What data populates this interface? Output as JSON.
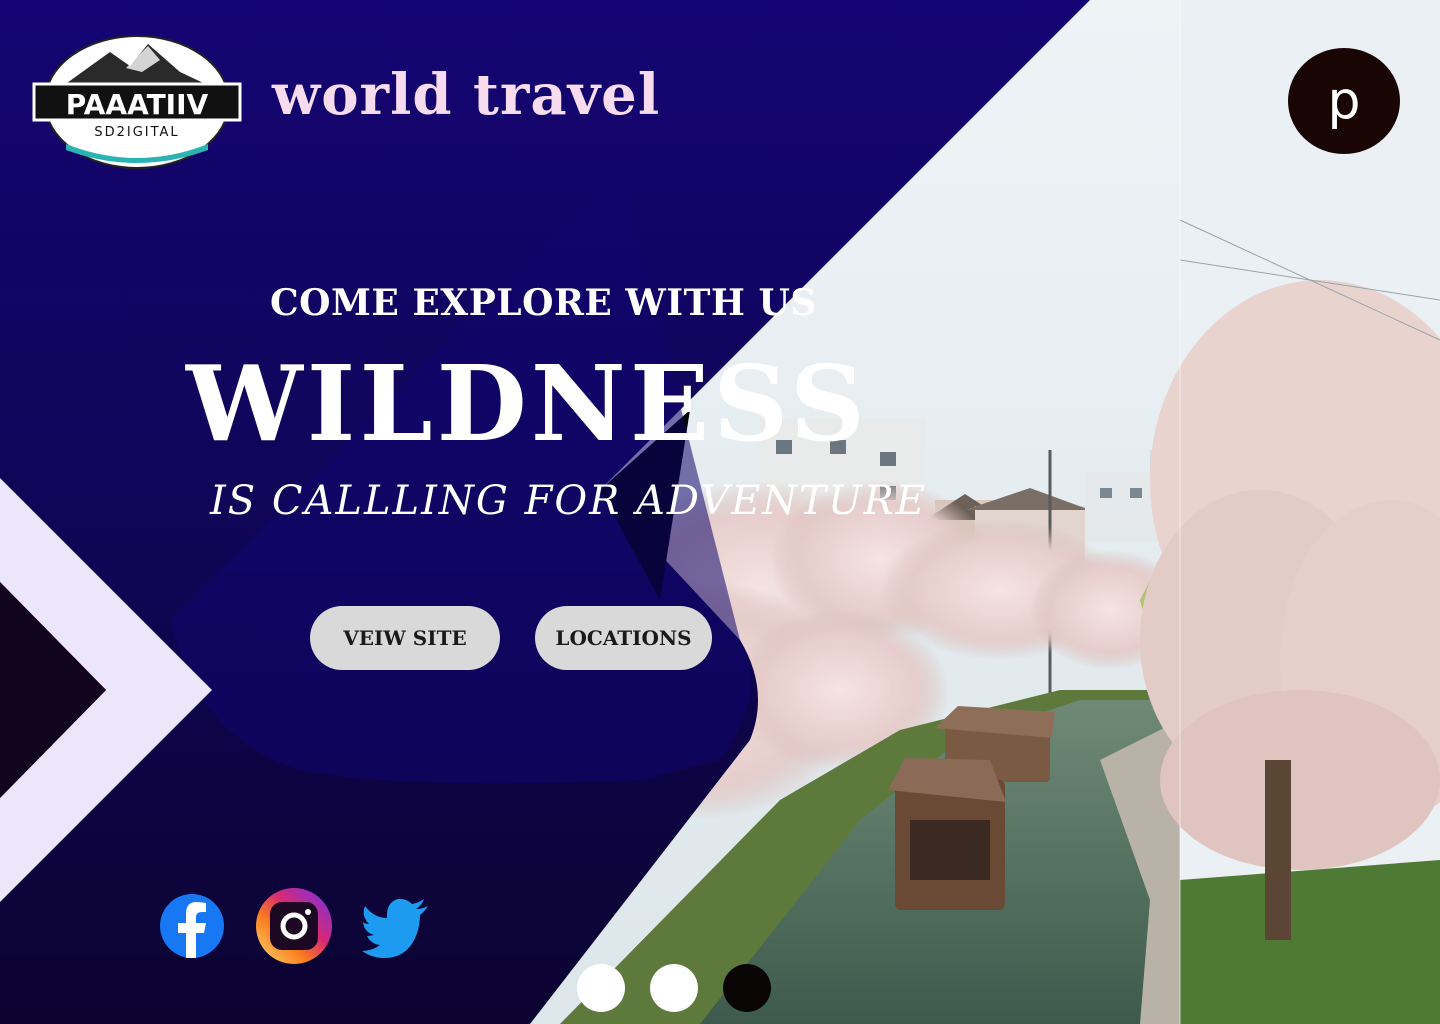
{
  "logo": {
    "main_text": "PAAATIIV",
    "sub_text": "SD2IGITAL"
  },
  "header": {
    "site_title": "world travel",
    "profile_button_label": "p"
  },
  "hero": {
    "tagline": "COME EXPLORE WITH US",
    "headline": "WILDNESS",
    "subline": "IS CALLLING FOR ADVENTURE"
  },
  "buttons": {
    "view_site": "VEIW SITE",
    "locations": "LOCATIONS"
  },
  "social": {
    "icons": [
      "facebook-icon",
      "instagram-icon",
      "twitter-icon"
    ]
  },
  "carousel": {
    "dot_count": 3,
    "active_index": 2
  },
  "colors": {
    "navy": "#12056e",
    "deep_navy": "#0e0738",
    "chevron": "#ece6fa",
    "title_pink": "#f6dcec",
    "button_gray": "#d9d9d9",
    "profile_dark": "#1a0505",
    "facebook_blue": "#1877f2",
    "twitter_blue": "#1d9bf0"
  }
}
